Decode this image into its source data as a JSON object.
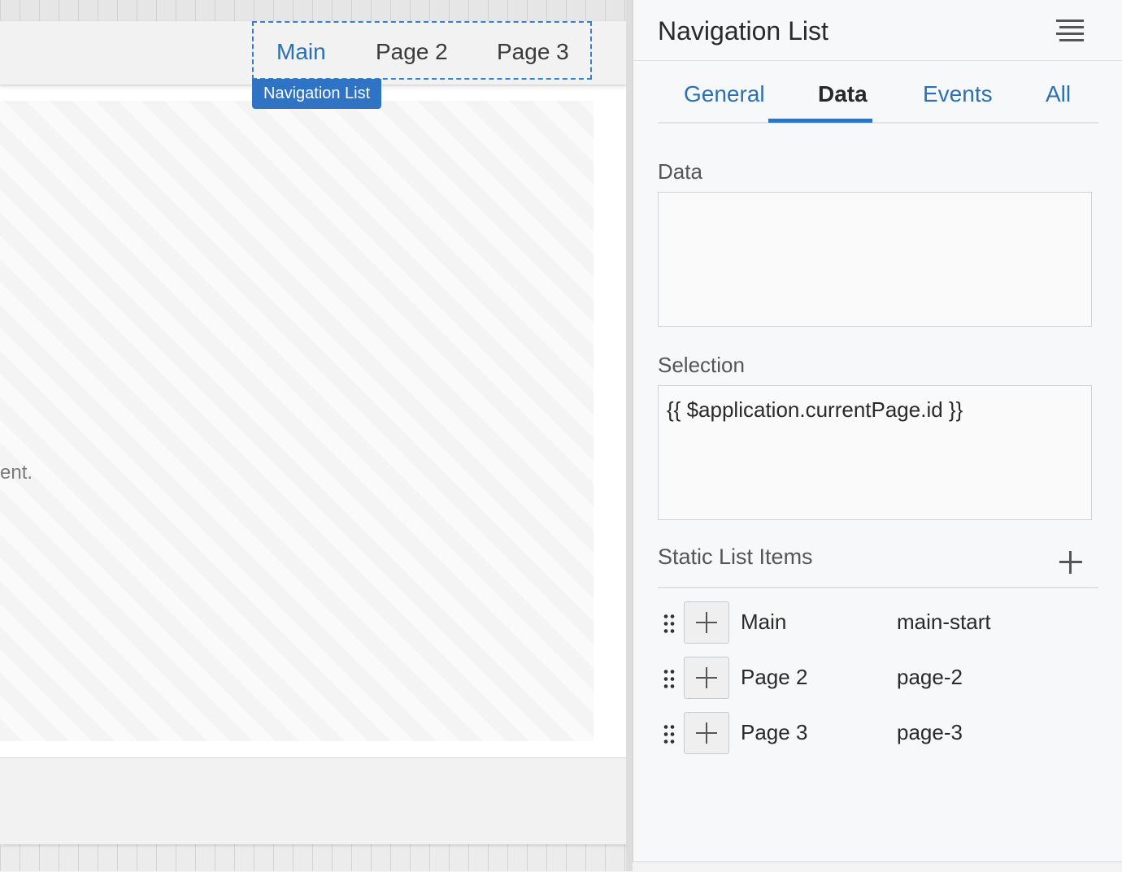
{
  "canvas": {
    "nav_items": [
      {
        "label": "Main",
        "active": true
      },
      {
        "label": "Page 2",
        "active": false
      },
      {
        "label": "Page 3",
        "active": false
      }
    ],
    "selection_tag": "Navigation List",
    "content_text": "ent."
  },
  "panel": {
    "title": "Navigation List",
    "menu_icon": "hamburger-menu-icon",
    "tabs": [
      {
        "label": "General",
        "active": false
      },
      {
        "label": "Data",
        "active": true
      },
      {
        "label": "Events",
        "active": false
      },
      {
        "label": "All",
        "active": false
      }
    ],
    "data_label": "Data",
    "data_value": "",
    "selection_label": "Selection",
    "selection_value": "{{ $application.currentPage.id }}",
    "static_items_label": "Static List Items",
    "items": [
      {
        "label": "Main",
        "value": "main-start"
      },
      {
        "label": "Page 2",
        "value": "page-2"
      },
      {
        "label": "Page 3",
        "value": "page-3"
      }
    ]
  },
  "colors": {
    "accent": "#2f73c4",
    "link": "#2b6fb5"
  }
}
